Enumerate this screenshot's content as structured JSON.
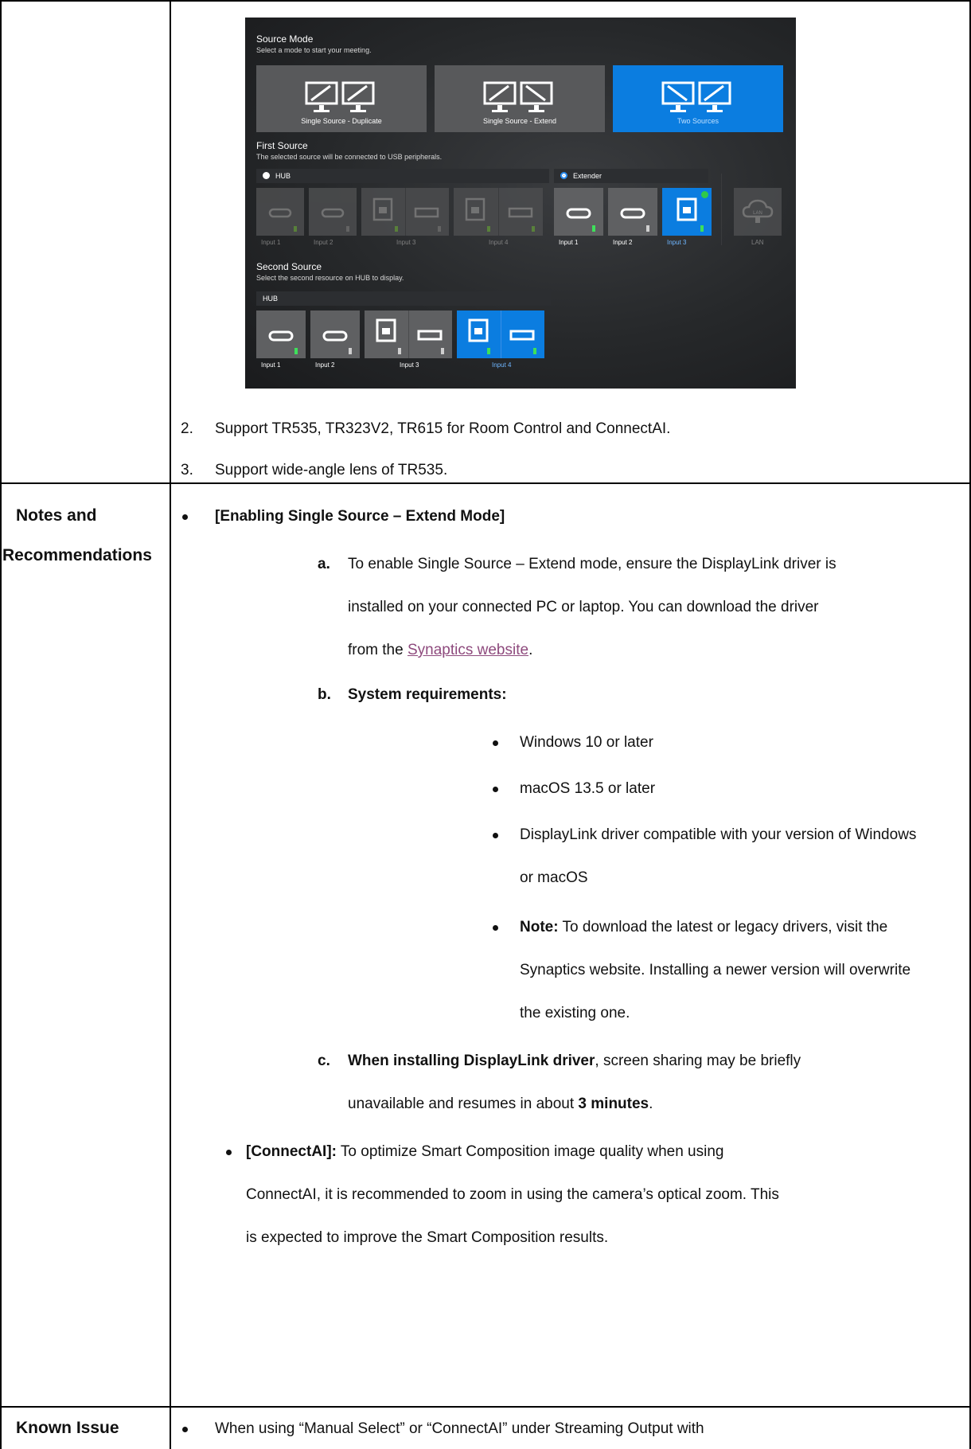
{
  "screenshot": {
    "source_mode": {
      "title": "Source Mode",
      "subtitle": "Select a mode to start your meeting.",
      "modes": [
        "Single Source - Duplicate",
        "Single Source - Extend",
        "Two Sources"
      ],
      "selected": "Two Sources"
    },
    "first_source": {
      "title": "First Source",
      "subtitle": "The selected source will be connected to USB peripherals.",
      "hub_label": "HUB",
      "extender_label": "Extender",
      "hub_inputs": [
        "Input 1",
        "Input 2",
        "Input 3",
        "Input 4"
      ],
      "extender_inputs": [
        "Input 1",
        "Input 2",
        "Input 3"
      ],
      "lan_label": "LAN",
      "lan_icon_text": "LAN"
    },
    "second_source": {
      "title": "Second Source",
      "subtitle": "Select the second resource on HUB to display.",
      "hub_label": "HUB",
      "inputs": [
        "Input 1",
        "Input 2",
        "Input 3",
        "Input 4"
      ]
    }
  },
  "list_items": [
    {
      "num": "2.",
      "text": "Support TR535, TR323V2, TR615 for Room Control and ConnectAI."
    },
    {
      "num": "3.",
      "text": "Support wide-angle lens of TR535."
    }
  ],
  "notes": {
    "label_line1": "Notes and",
    "label_line2": "Recommendations",
    "heading": "[Enabling Single Source – Extend Mode]",
    "a_marker": "a.",
    "a_line1": "To enable Single Source – Extend mode, ensure the DisplayLink driver is",
    "a_line2": "installed on your connected PC or laptop. You can download the driver",
    "a_line3_pre": "from the ",
    "a_link": "Synaptics website",
    "a_line3_post": ".",
    "b_marker": "b.",
    "b_text": "System requirements:",
    "req1": "Windows 10 or later",
    "req2": "macOS 13.5 or later",
    "req3_line1": "DisplayLink driver compatible with your version of Windows",
    "req3_line2": "or macOS",
    "req4_bold": "Note:",
    "req4_line1": " To download the latest or legacy drivers, visit the",
    "req4_line2": "Synaptics website. Installing a newer version will overwrite",
    "req4_line3": "the existing one.",
    "c_marker": "c.",
    "c_bold": "When installing DisplayLink driver",
    "c_line1": ", screen sharing may be briefly",
    "c_line2_pre": "unavailable and resumes in about ",
    "c_line2_bold": "3 minutes",
    "c_line2_post": ".",
    "ai_bold": "[ConnectAI]:",
    "ai_line1": " To optimize Smart Composition image quality when using",
    "ai_line2": "ConnectAI, it is recommended to zoom in using the camera’s optical zoom. This",
    "ai_line3": "is expected to improve the Smart Composition results."
  },
  "known_issue": {
    "label": "Known Issue",
    "text": "When using “Manual Select” or “ConnectAI” under Streaming Output with"
  }
}
